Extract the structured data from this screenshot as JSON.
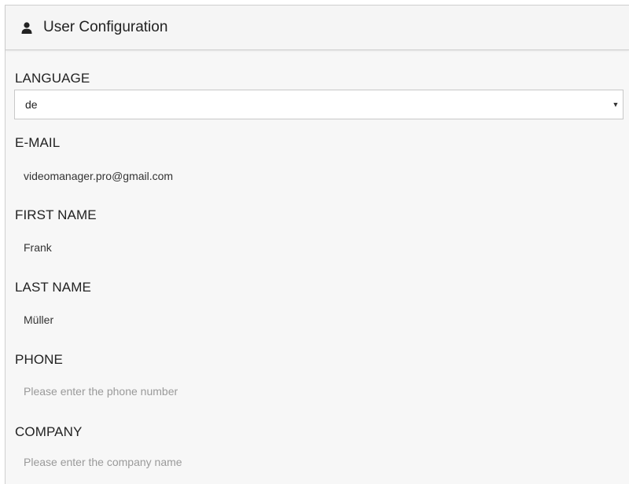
{
  "header": {
    "icon": "user-icon",
    "title": "User Configuration"
  },
  "language": {
    "label": "LANGUAGE",
    "selected": "de"
  },
  "email": {
    "label": "E-MAIL",
    "value": "videomanager.pro@gmail.com"
  },
  "first_name": {
    "label": "FIRST NAME",
    "value": "Frank"
  },
  "last_name": {
    "label": "LAST NAME",
    "value": "Müller"
  },
  "phone": {
    "label": "PHONE",
    "placeholder": "Please enter the phone number"
  },
  "company": {
    "label": "COMPANY",
    "placeholder": "Please enter the company name"
  },
  "colors": {
    "header_bg": "#f5f5f5",
    "body_bg": "#f7f7f7",
    "placeholder_text": "#9a9a9a"
  }
}
